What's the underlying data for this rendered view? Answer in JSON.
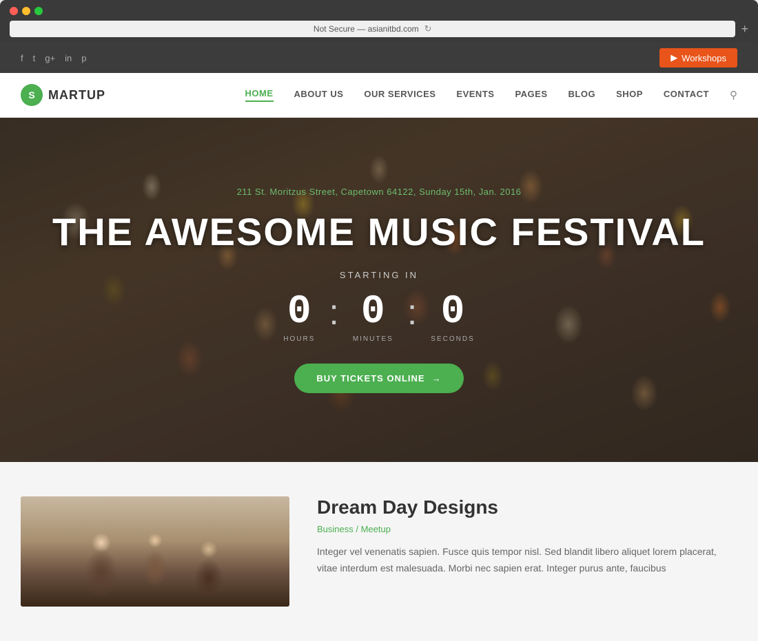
{
  "browser": {
    "address": "Not Secure — asianitbd.com",
    "dots": [
      "red",
      "yellow",
      "green"
    ]
  },
  "topbar": {
    "workshops_label": "Workshops",
    "workshops_arrow": "▶",
    "social_links": [
      "f",
      "t",
      "g+",
      "in",
      "p"
    ]
  },
  "nav": {
    "logo_letter": "S",
    "logo_text": "MARTUP",
    "links": [
      {
        "label": "HOME",
        "active": true
      },
      {
        "label": "ABOUT US",
        "active": false
      },
      {
        "label": "OUR SERVICES",
        "active": false
      },
      {
        "label": "EVENTS",
        "active": false
      },
      {
        "label": "PAGES",
        "active": false
      },
      {
        "label": "BLOG",
        "active": false
      },
      {
        "label": "SHOP",
        "active": false
      },
      {
        "label": "CONTACT",
        "active": false
      }
    ]
  },
  "hero": {
    "address_text": "211 St. Moritzus Street, Capetown 64122, Sunday 15th, Jan. 2016",
    "title": "THE AWESOME MUSIC FESTIVAL",
    "starting_label": "STARTING IN",
    "countdown": {
      "hours": "0",
      "minutes": "0",
      "seconds": "0",
      "hours_label": "HOURS",
      "minutes_label": "MINUTES",
      "seconds_label": "SECONDS"
    },
    "buy_btn_label": "BUY TICKETS ONLINE",
    "buy_btn_arrow": "→"
  },
  "content": {
    "image_alt": "workshop people",
    "title": "Dream Day Designs",
    "category": "Business / Meetup",
    "body": "Integer vel venenatis sapien. Fusce quis tempor nisl. Sed blandit libero aliquet lorem placerat, vitae interdum est malesuada. Morbi nec sapien erat. Integer purus ante, faucibus"
  }
}
